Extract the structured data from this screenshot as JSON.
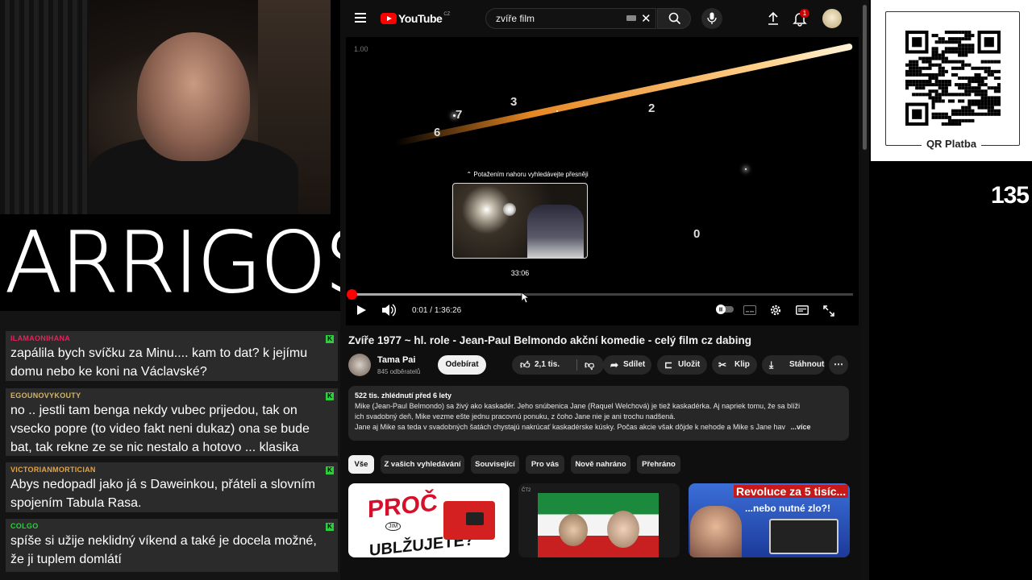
{
  "stream": {
    "logo_text": "ARRIGOS",
    "viewer_count": "135",
    "qr_label": "QR Platba"
  },
  "chat": {
    "messages": [
      {
        "user": "ILAMAONIHANA",
        "color": "#e0245e",
        "text": "zapálila bych svíčku za Minu.... kam to dat? k jejímu domu nebo ke koni na Václavské?"
      },
      {
        "user": "EGOUNOVYKOUTY",
        "color": "#d4b46a",
        "text": "no .. jestli tam benga nekdy vubec prijedou, tak on vsecko popre (to video fakt neni dukaz) ona se bude bat, tak rekne ze se nic nestalo a hotovo ... klasika"
      },
      {
        "user": "VICTORIANMORTICIAN",
        "color": "#e8a33d",
        "text": "Abys nedopadl jako já s Daweinkou, přáteli a slovním spojením Tabula Rasa."
      },
      {
        "user": "COLGO",
        "color": "#2ecc40",
        "text": "spíše si užije neklidný víkend a také je docela možné, že ji tuplem domlátí"
      }
    ]
  },
  "youtube": {
    "logo_word": "YouTube",
    "logo_region": "CZ",
    "search_value": "zvíře film",
    "notifications": "1",
    "player": {
      "film_tag": "1.00",
      "leader_numbers": {
        "n3": "3",
        "n2": "2",
        "n7": "7",
        "n6": "6",
        "n0": "0"
      },
      "seek_hint": "Potažením nahoru vyhledávejte přesněji",
      "seek_time": "33:06",
      "time_current": "0:01",
      "time_total": "1:36:26",
      "played_fraction": 0.0002,
      "hover_fraction": 0.343
    },
    "video": {
      "title": "Zvíře 1977 ~ hl. role - Jean-Paul Belmondo akční komedie - celý film cz dabing",
      "channel": "Tama Pai",
      "subscribers": "845 odběratelů",
      "subscribe_label": "Odebírat",
      "likes": "2,1 tis.",
      "share_label": "Sdílet",
      "save_label": "Uložit",
      "clip_label": "Klip",
      "download_label": "Stáhnout"
    },
    "description": {
      "meta": "522 tis. zhlédnutí  před 6 lety",
      "line1": "Mike (Jean-Paul Belmondo) sa živý ako kaskadér. Jeho snúbenica Jane (Raquel Welchová) je tiež kaskadérka. Aj napriek tomu, že sa blíži",
      "line2": "ich svadobný deň, Mike vezme ešte jednu pracovnú ponuku, z čoho Jane nie je ani trochu nadšená.",
      "line3": "Jane aj Mike sa teda v svadobných šatách chystajú nakrúcať kaskadérske kúsky. Počas akcie však dôjde k nehode a Mike s Jane hav",
      "more": "...více"
    },
    "chips": [
      "Vše",
      "Z vašich vyhledávání",
      "Související",
      "Pro vás",
      "Nově nahráno",
      "Přehráno"
    ],
    "thumbnails": {
      "t1_main": "PROČ",
      "t1_sub": "UBLŽUJETE?",
      "t1_small": "JIM",
      "t2_tag": "ČT2",
      "t3_line1": "Revoluce za 5 tisíc...",
      "t3_line2": "...nebo nutné zlo?!"
    }
  }
}
